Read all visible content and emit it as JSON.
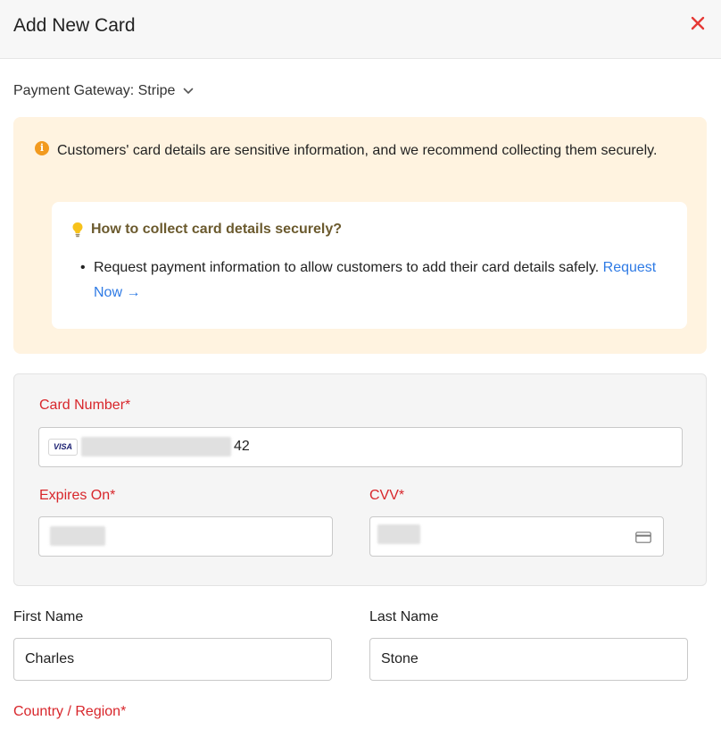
{
  "dialog": {
    "title": "Add New Card"
  },
  "gateway": {
    "label": "Payment Gateway: Stripe"
  },
  "notice": {
    "message": "Customers' card details are sensitive information, and we recommend collecting them securely.",
    "tip_title": "How to collect card details securely?",
    "bullet": "•",
    "tip_text": "Request payment information to allow customers to add their card details safely.",
    "link": "Request Now →"
  },
  "card": {
    "number_label": "Card Number*",
    "brand": "VISA",
    "number_suffix": "42",
    "expires_label": "Expires On*",
    "cvv_label": "CVV*"
  },
  "name": {
    "first_label": "First Name",
    "first_value": "Charles",
    "last_label": "Last Name",
    "last_value": "Stone"
  },
  "country": {
    "label": "Country / Region*"
  },
  "colors": {
    "required": "#d8262b",
    "link": "#2f7be5",
    "notice_bg": "#fff3e0",
    "close": "#e53935"
  }
}
